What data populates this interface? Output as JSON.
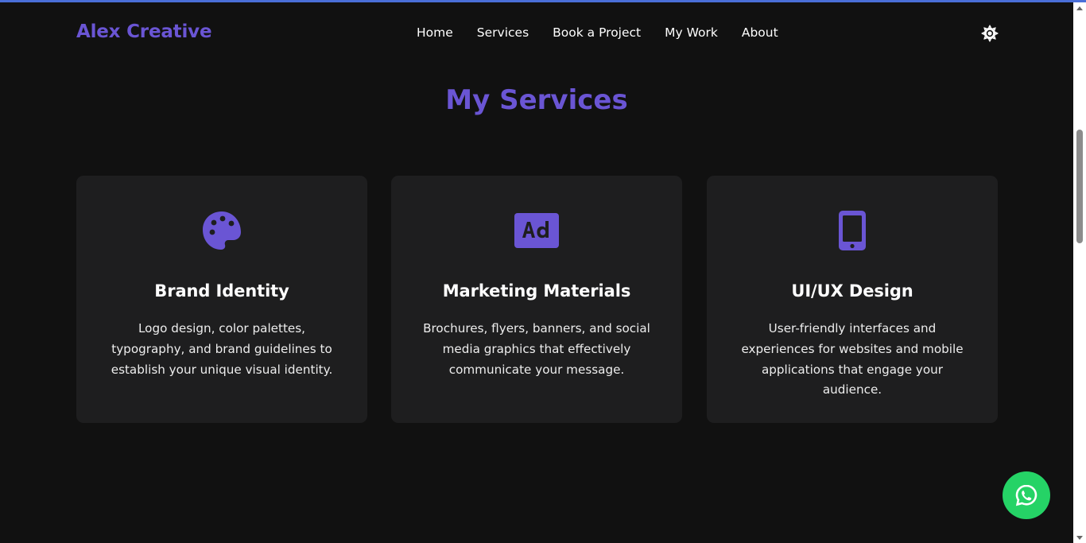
{
  "colors": {
    "accent": "#6a55d4",
    "background": "#111111",
    "card_background": "#1e1e1f",
    "whatsapp": "#25d366"
  },
  "header": {
    "brand": "Alex Creative",
    "nav": [
      {
        "label": "Home"
      },
      {
        "label": "Services"
      },
      {
        "label": "Book a Project"
      },
      {
        "label": "My Work"
      },
      {
        "label": "About"
      }
    ],
    "theme_toggle_icon": "sun-icon"
  },
  "services": {
    "title": "My Services",
    "cards": [
      {
        "icon": "palette-icon",
        "title": "Brand Identity",
        "description": "Logo design, color palettes, typography, and brand guidelines to establish your unique visual identity."
      },
      {
        "icon": "ad-icon",
        "title": "Marketing Materials",
        "description": "Brochures, flyers, banners, and social media graphics that effectively communicate your message."
      },
      {
        "icon": "mobile-phone-icon",
        "title": "UI/UX Design",
        "description": "User-friendly interfaces and experiences for websites and mobile applications that engage your audience."
      }
    ]
  },
  "floating": {
    "whatsapp_icon": "whatsapp-icon"
  }
}
